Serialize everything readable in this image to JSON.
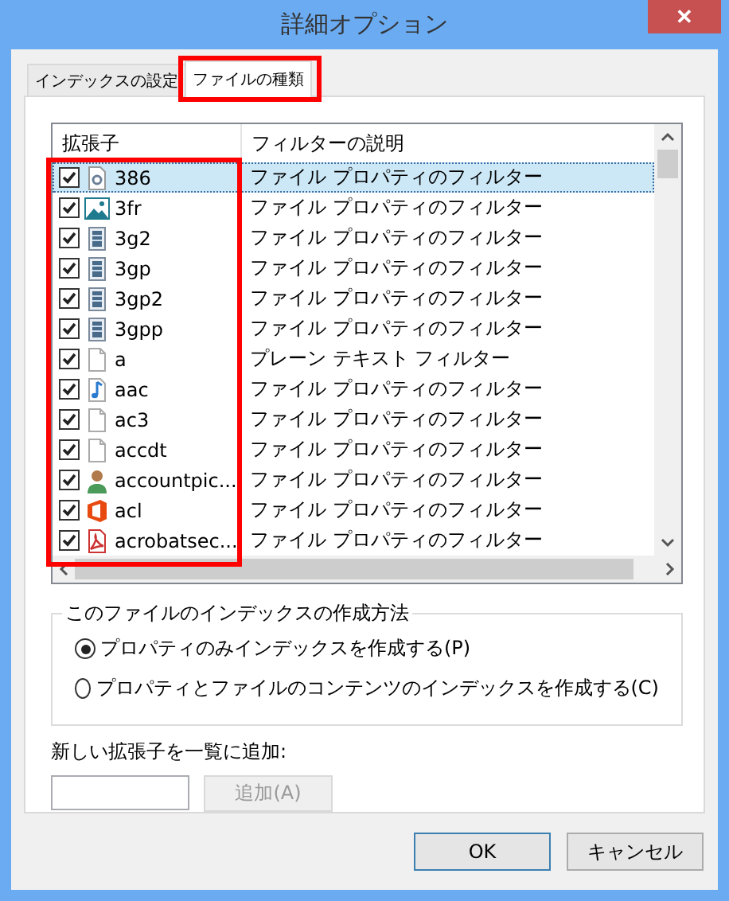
{
  "window": {
    "title": "詳細オプション",
    "close": "✕"
  },
  "tabs": [
    {
      "label": "インデックスの設定",
      "selected": false
    },
    {
      "label": "ファイルの種類",
      "selected": true
    }
  ],
  "list": {
    "columns": [
      "拡張子",
      "フィルターの説明"
    ],
    "rows": [
      {
        "ext": "386",
        "kind": "gear",
        "checked": true,
        "selected": true,
        "description": "ファイル プロパティのフィルター"
      },
      {
        "ext": "3fr",
        "kind": "image",
        "checked": true,
        "selected": false,
        "description": "ファイル プロパティのフィルター"
      },
      {
        "ext": "3g2",
        "kind": "video",
        "checked": true,
        "selected": false,
        "description": "ファイル プロパティのフィルター"
      },
      {
        "ext": "3gp",
        "kind": "video",
        "checked": true,
        "selected": false,
        "description": "ファイル プロパティのフィルター"
      },
      {
        "ext": "3gp2",
        "kind": "video",
        "checked": true,
        "selected": false,
        "description": "ファイル プロパティのフィルター"
      },
      {
        "ext": "3gpp",
        "kind": "video",
        "checked": true,
        "selected": false,
        "description": "ファイル プロパティのフィルター"
      },
      {
        "ext": "a",
        "kind": "blank",
        "checked": true,
        "selected": false,
        "description": "プレーン テキスト フィルター"
      },
      {
        "ext": "aac",
        "kind": "audio",
        "checked": true,
        "selected": false,
        "description": "ファイル プロパティのフィルター"
      },
      {
        "ext": "ac3",
        "kind": "blank",
        "checked": true,
        "selected": false,
        "description": "ファイル プロパティのフィルター"
      },
      {
        "ext": "accdt",
        "kind": "blank",
        "checked": true,
        "selected": false,
        "description": "ファイル プロパティのフィルター"
      },
      {
        "ext": "accountpic...",
        "kind": "user",
        "checked": true,
        "selected": false,
        "description": "ファイル プロパティのフィルター"
      },
      {
        "ext": "acl",
        "kind": "office",
        "checked": true,
        "selected": false,
        "description": "ファイル プロパティのフィルター"
      },
      {
        "ext": "acrobatsec...",
        "kind": "pdf",
        "checked": true,
        "selected": false,
        "description": "ファイル プロパティのフィルター"
      }
    ]
  },
  "index_method": {
    "title": "このファイルのインデックスの作成方法",
    "options": [
      {
        "label": "プロパティのみインデックスを作成する(P)",
        "selected": true
      },
      {
        "label": "プロパティとファイルのコンテンツのインデックスを作成する(C)",
        "selected": false
      }
    ]
  },
  "add_extension": {
    "label": "新しい拡張子を一覧に追加:",
    "button": "追加(A)",
    "button_disabled": true
  },
  "buttons": [
    {
      "label": "OK",
      "default": true
    },
    {
      "label": "キャンセル",
      "default": false
    }
  ]
}
